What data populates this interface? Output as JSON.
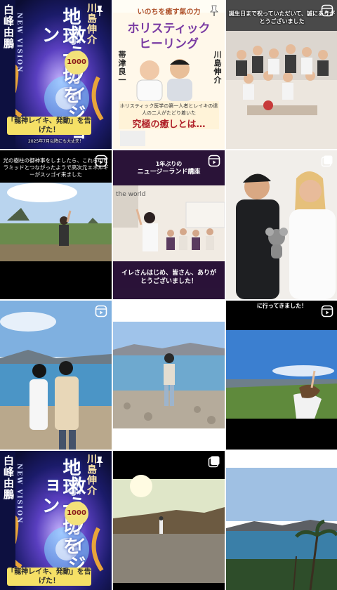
{
  "grid": {
    "row1": {
      "book": {
        "author_left": "白峰由鵬",
        "author_right": "川島伸介",
        "title_line1": "地球一切を",
        "title_line2": "救うヴィジョン",
        "series": "NEW VISION",
        "badge_number": "1000",
        "badge_small": "次元が変わる",
        "bottom_text": "「龍神レイキ、発動」を告げた！",
        "tiny_text": "2025年7月以降にも大丈夫！"
      },
      "healing": {
        "top_line": "いのちを癒す氣の力",
        "title_1": "ホリスティック",
        "title_2": "ヒーリング",
        "author_left": "帯津良一",
        "author_right": "川島伸介",
        "subtitle": "ホリスティック医学の第一人者とレイキの達人の二人がたどり着いた",
        "headline": "究極の癒しとは…"
      },
      "party": {
        "caption": "誕生日まで祝っていただいて、誠にありがとうございました"
      }
    },
    "row2": {
      "pyramid": {
        "caption": "光の樹柱の御神事をしましたら、これらのピラミッドとつながったようで高次元エネルギーがスッゴイ来ました"
      },
      "nz": {
        "top_caption": "1年ぶりの",
        "top_caption2": "ニュージーランド講座",
        "bottom_caption": "イレさんはじめ、皆さん、ありがとうございました！",
        "wall_text": "the world"
      },
      "koala": {}
    },
    "row3": {
      "lake": {},
      "stone": {},
      "city": {
        "caption": "に行ってきました！"
      }
    },
    "row4": {
      "book": {
        "author_left": "白峰由鵬",
        "author_right": "川島伸介",
        "title_line1": "地球一切を",
        "title_line2": "救うヴィジョン",
        "series": "NEW VISION",
        "badge_number": "1000",
        "bottom_text": "「龍神レイキ、発動」を告げた！"
      },
      "cliff": {},
      "ocean": {}
    }
  },
  "icons": {
    "reel": "reels-icon",
    "pin": "pin-icon",
    "multi": "carousel-icon"
  }
}
